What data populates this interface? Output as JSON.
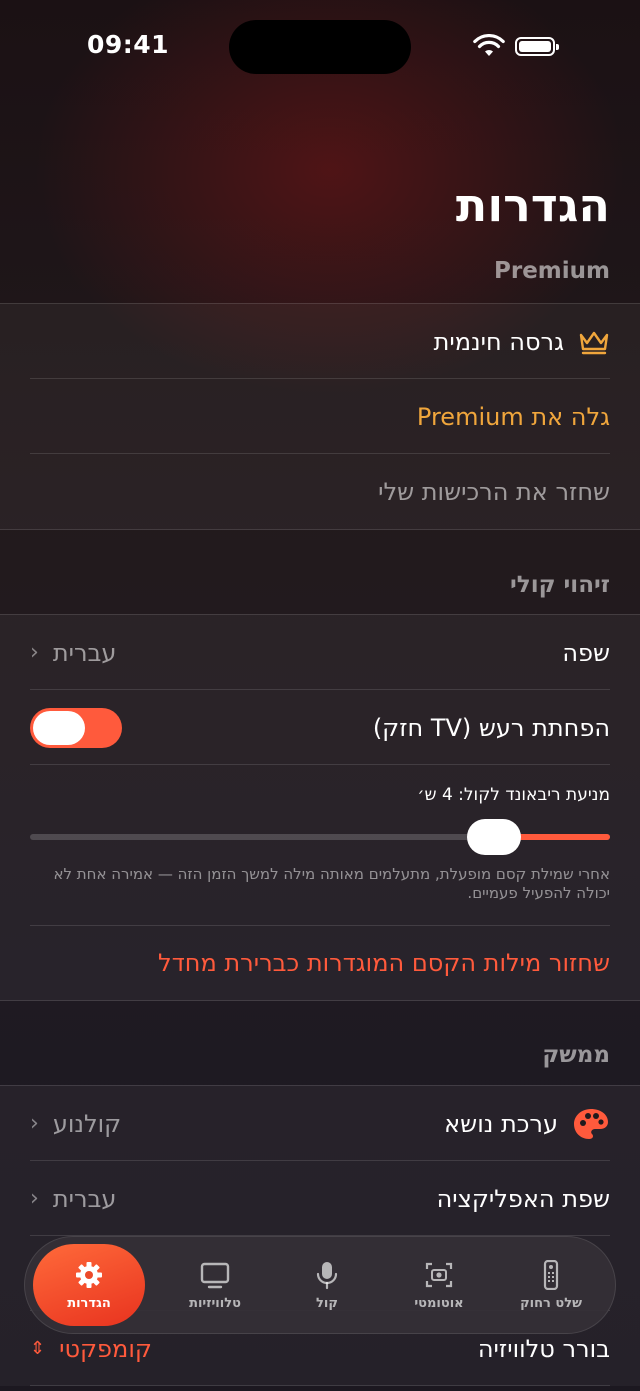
{
  "status": {
    "time": "09:41"
  },
  "page": {
    "title": "הגדרות"
  },
  "premium": {
    "header": "Premium",
    "free_version": "גרסה חינמית",
    "discover": "גלה את Premium",
    "restore": "שחזר את הרכישות שלי"
  },
  "voice": {
    "header": "זיהוי קולי",
    "language_label": "שפה",
    "language_value": "עברית",
    "noise_label": "הפחתת רעש (TV חזק)",
    "noise_enabled": true,
    "rebound_label": "מניעת ריבאונד לקול: 4 ש׳",
    "rebound_fraction": 0.8,
    "rebound_hint": "אחרי שמילת קסם מופעלת, מתעלמים מאותה מילה למשך הזמן הזה — אמירה אחת לא יכולה להפעיל פעמיים.",
    "reset_magic": "שחזור מילות הקסם המוגדרות כברירת מחדל"
  },
  "interface": {
    "header": "ממשק",
    "theme_label": "ערכת נושא",
    "theme_value": "קולנוע",
    "app_language_label": "שפת האפליקציה",
    "app_language_value": "עברית",
    "tv_picker_label": "בורר טלוויזיה",
    "tv_picker_value": "קומפקטי"
  },
  "colors": {
    "accent": "#ff5a3c",
    "premium": "#f0a63c"
  },
  "tabs": [
    {
      "label": "הגדרות",
      "icon": "gear-icon",
      "active": true
    },
    {
      "label": "טלוויזיות",
      "icon": "tv-icon",
      "active": false
    },
    {
      "label": "קול",
      "icon": "mic-icon",
      "active": false
    },
    {
      "label": "אוטומטי",
      "icon": "camera-scan-icon",
      "active": false
    },
    {
      "label": "שלט רחוק",
      "icon": "remote-icon",
      "active": false
    }
  ]
}
